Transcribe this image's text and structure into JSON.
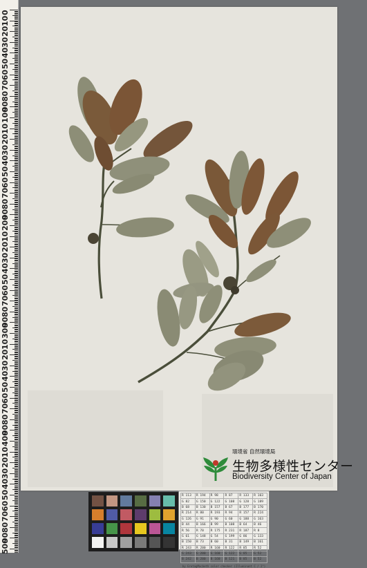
{
  "ruler": {
    "labels": [
      "0",
      "10",
      "20",
      "30",
      "40",
      "50",
      "60",
      "70",
      "80",
      "90",
      "100",
      "10",
      "20",
      "30",
      "40",
      "50",
      "60",
      "70",
      "80",
      "90",
      "200",
      "10",
      "20",
      "30",
      "40",
      "50",
      "60",
      "70",
      "80",
      "90",
      "300",
      "10",
      "20",
      "30",
      "40",
      "50",
      "60",
      "70",
      "80",
      "90",
      "400",
      "10",
      "20",
      "30",
      "40",
      "50",
      "60",
      "70",
      "80",
      "90",
      "500",
      "10"
    ]
  },
  "logo": {
    "agency": "環境省 自然環境局",
    "title_jp": "生物多様性センター",
    "title_en": "Biodiversity Center of Japan",
    "mark_color": "#2e8b3a",
    "icon": "biodiversity-center-logo-icon"
  },
  "colorchart": {
    "swatches": [
      "#735244",
      "#c29682",
      "#627a9d",
      "#576c43",
      "#8580b1",
      "#67bdaa",
      "#d67e2c",
      "#505ba6",
      "#c15a63",
      "#5e3c6c",
      "#9dbc40",
      "#e0a32e",
      "#383d96",
      "#469449",
      "#af363c",
      "#e7c71f",
      "#bb5695",
      "#0885a1",
      "#f3f3f2",
      "#c8c8c8",
      "#a0a0a0",
      "#7a7a79",
      "#555555",
      "#343434"
    ]
  },
  "graycard": {
    "rows": [
      [
        "R 113",
        "R 194",
        "R 98",
        "R 87",
        "R 133",
        "R 103"
      ],
      [
        "G 82",
        "G 150",
        "G 122",
        "G 108",
        "G 128",
        "G 189"
      ],
      [
        "B 68",
        "B 130",
        "B 157",
        "B 67",
        "B 177",
        "B 170"
      ],
      [
        "R 214",
        "R 80",
        "R 193",
        "R 94",
        "R 157",
        "R 224"
      ],
      [
        "G 126",
        "G 91",
        "G 90",
        "G 60",
        "G 188",
        "G 163"
      ],
      [
        "B 44",
        "B 166",
        "B 99",
        "B 108",
        "B 64",
        "B 46"
      ],
      [
        "R 56",
        "R 70",
        "R 175",
        "R 231",
        "R 187",
        "R 8"
      ],
      [
        "G 61",
        "G 148",
        "G 54",
        "G 199",
        "G 86",
        "G 133"
      ],
      [
        "B 150",
        "B 73",
        "B 60",
        "B 31",
        "B 149",
        "B 161"
      ],
      [
        "R 243",
        "R 200",
        "R 160",
        "R 122",
        "R 85",
        "R 52"
      ],
      [
        "G 243",
        "G 200",
        "G 160",
        "G 122",
        "G 85",
        "G 52"
      ],
      [
        "B 242",
        "B 200",
        "B 160",
        "B 121",
        "B 85",
        "B 52"
      ]
    ],
    "footer": "by GretagMacbeth color checker (Illuminant C / 2°)"
  }
}
